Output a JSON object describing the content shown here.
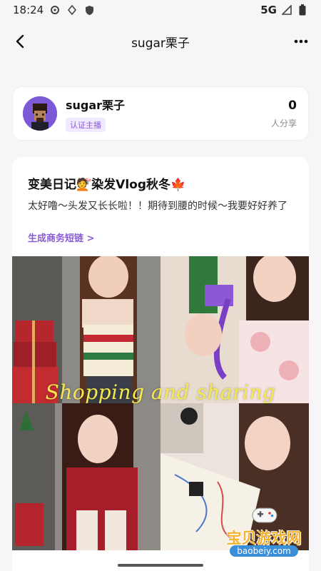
{
  "status_bar": {
    "time": "18:24",
    "network": "5G"
  },
  "header": {
    "title": "sugar栗子"
  },
  "profile": {
    "name": "sugar栗子",
    "badge": "认证主播",
    "share_count": "0",
    "share_label": "人分享"
  },
  "post": {
    "title": "变美日记💇染发Vlog秋冬🍁",
    "description": "太好噜～头发又长长啦！！期待到腰的时候～我要好好养了",
    "link_label": "生成商务短链 >",
    "overlay_caption": "Shopping and sharing"
  },
  "watermark": {
    "text": "宝贝游戏网",
    "url": "baobeiy.com"
  },
  "colors": {
    "accent": "#8a5cd8",
    "badge_bg": "#f1e9ff",
    "caption": "#f4e94d"
  }
}
